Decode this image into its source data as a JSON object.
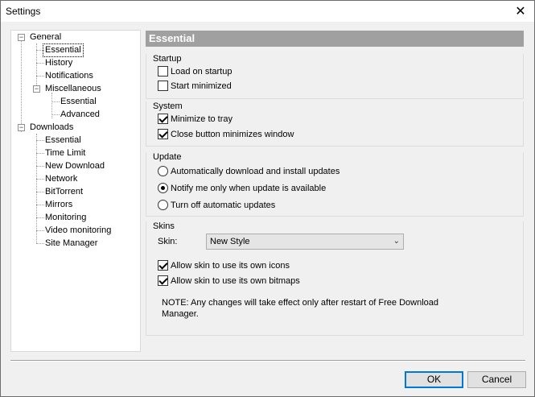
{
  "window": {
    "title": "Settings"
  },
  "tree": {
    "general": "General",
    "essential": "Essential",
    "history": "History",
    "notifications": "Notifications",
    "miscellaneous": "Miscellaneous",
    "misc_essential": "Essential",
    "misc_advanced": "Advanced",
    "downloads": "Downloads",
    "dl_essential": "Essential",
    "dl_time_limit": "Time Limit",
    "dl_new_download": "New Download",
    "dl_network": "Network",
    "dl_bittorrent": "BitTorrent",
    "dl_mirrors": "Mirrors",
    "dl_monitoring": "Monitoring",
    "dl_video_monitoring": "Video monitoring",
    "dl_site_manager": "Site Manager"
  },
  "panel": {
    "title": "Essential",
    "startup": {
      "title": "Startup",
      "load_on_startup": "Load on startup",
      "start_minimized": "Start minimized"
    },
    "system": {
      "title": "System",
      "minimize_to_tray": "Minimize to tray",
      "close_minimizes": "Close button minimizes window"
    },
    "update": {
      "title": "Update",
      "auto": "Automatically download and install updates",
      "notify": "Notify me only when update is available",
      "off": "Turn off automatic updates"
    },
    "skins": {
      "title": "Skins",
      "skin_label": "Skin:",
      "skin_value": "New Style",
      "own_icons": "Allow skin to use its own icons",
      "own_bitmaps": "Allow skin to use its own bitmaps",
      "note_line1": "NOTE: Any changes will take effect only after restart of Free Download",
      "note_line2": "Manager."
    }
  },
  "buttons": {
    "ok": "OK",
    "cancel": "Cancel"
  },
  "colors": {
    "header_bg": "#a0a0a0",
    "focus_blue": "#0078d7"
  }
}
